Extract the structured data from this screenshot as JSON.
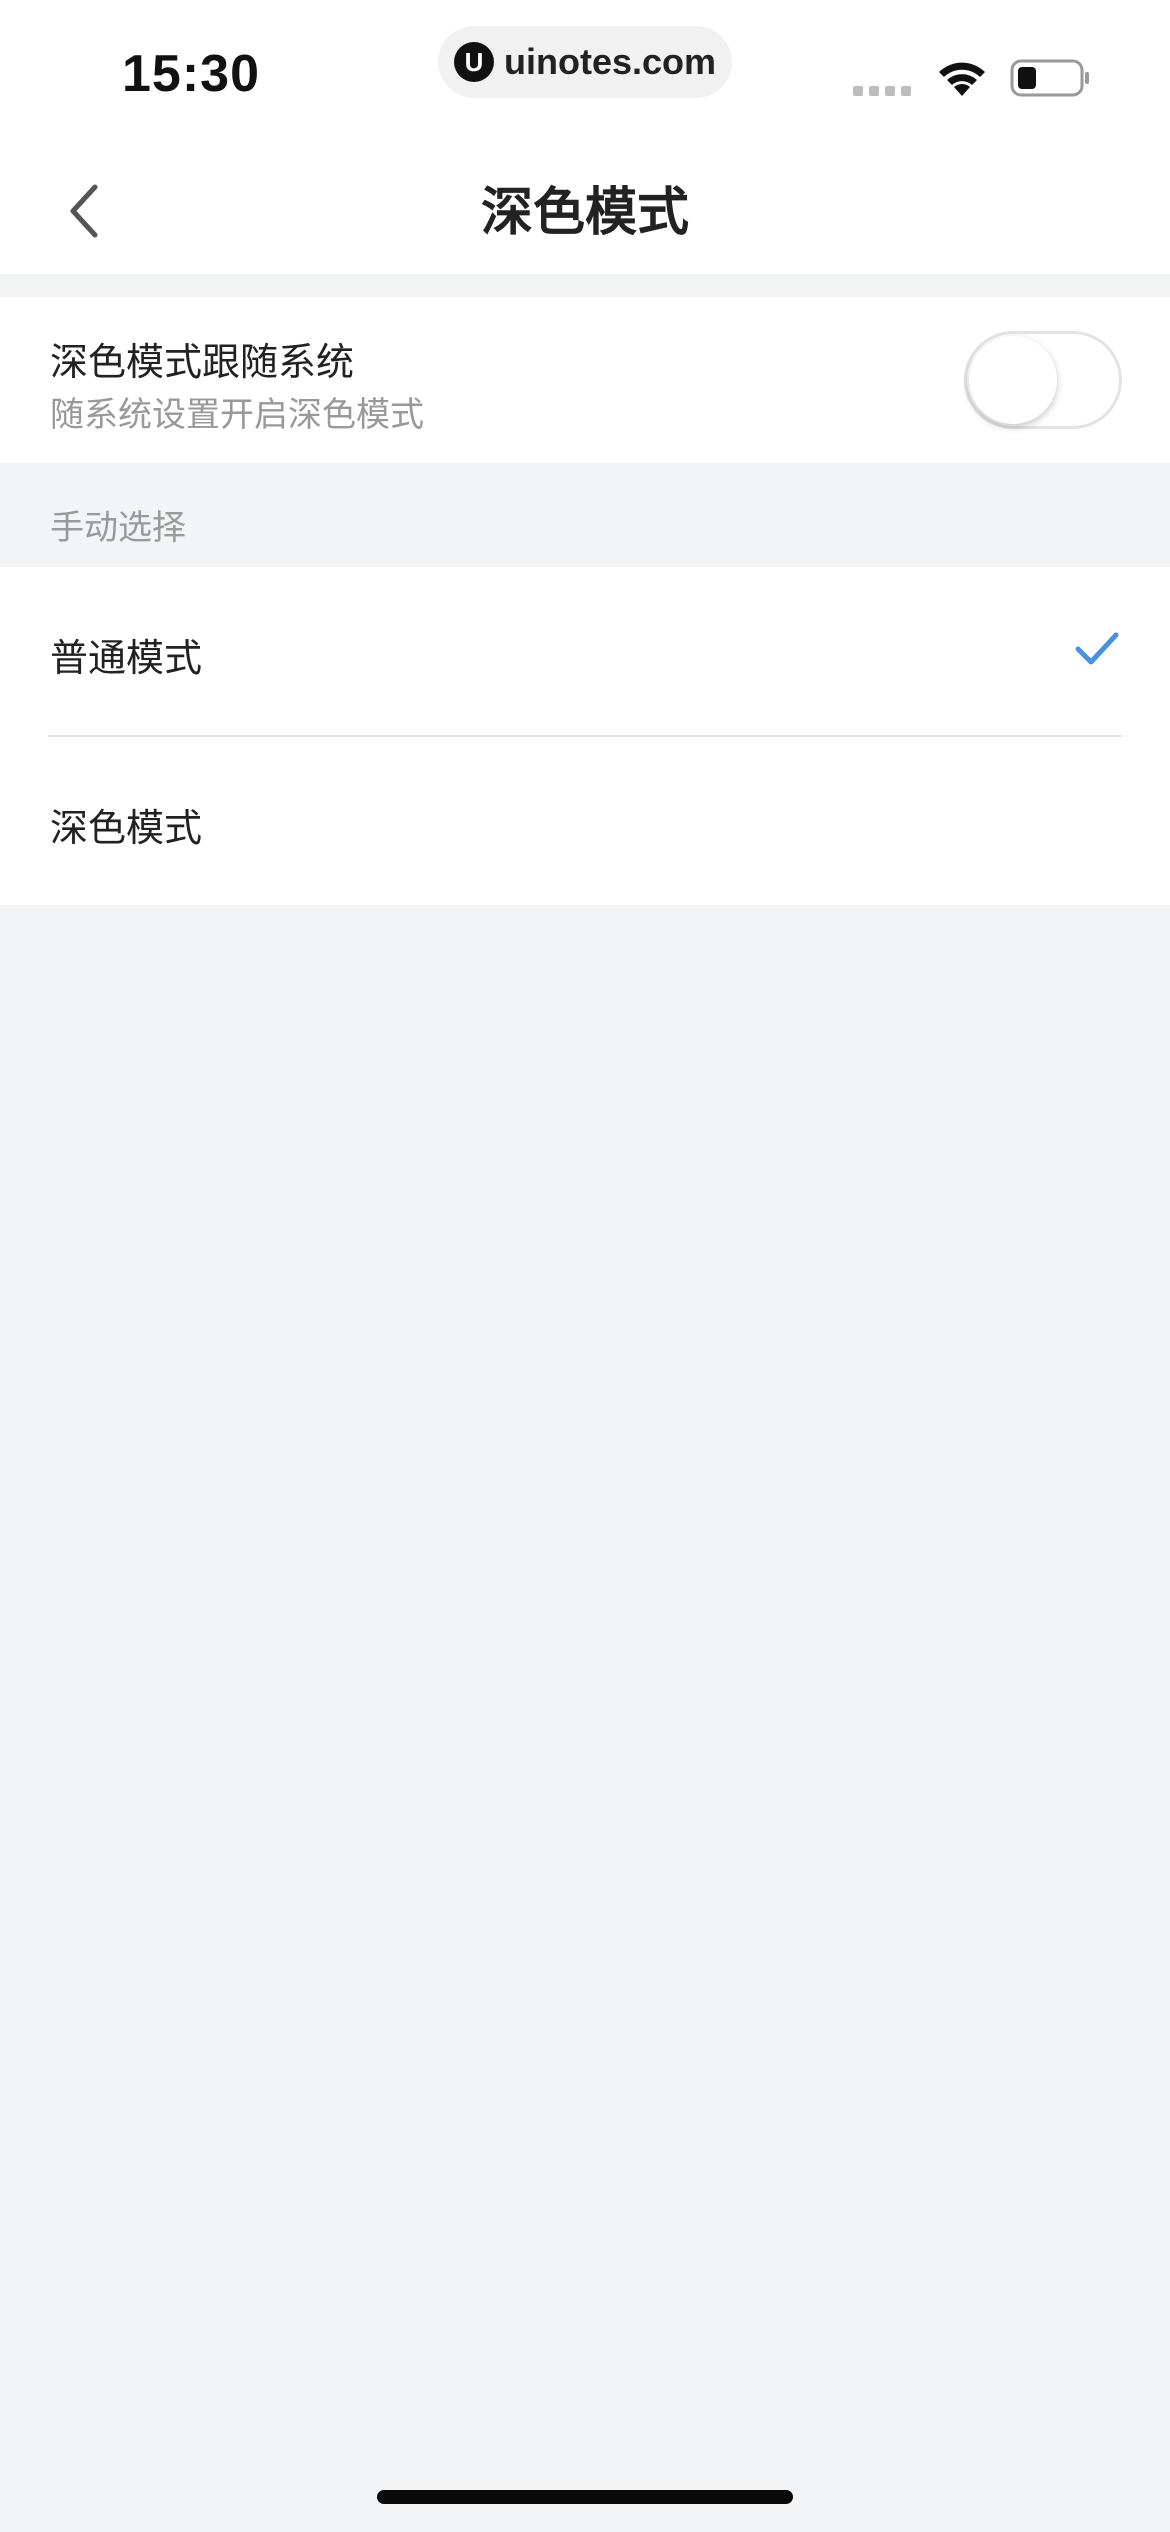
{
  "status_bar": {
    "time": "15:30",
    "url": "uinotes.com",
    "logo_glyph": "U",
    "icons": [
      "cellular-signal-icon",
      "wifi-icon",
      "battery-icon"
    ]
  },
  "nav": {
    "title": "深色模式",
    "back_icon": "chevron-left-icon"
  },
  "follow_system": {
    "title": "深色模式跟随系统",
    "subtitle": "随系统设置开启深色模式",
    "enabled": false
  },
  "manual": {
    "section_label": "手动选择",
    "options": [
      {
        "label": "普通模式",
        "selected": true
      },
      {
        "label": "深色模式",
        "selected": false
      }
    ]
  },
  "colors": {
    "accent": "#4a90e2",
    "background": "#f3f4f6",
    "card": "#ffffff",
    "secondary_text": "#999999"
  }
}
